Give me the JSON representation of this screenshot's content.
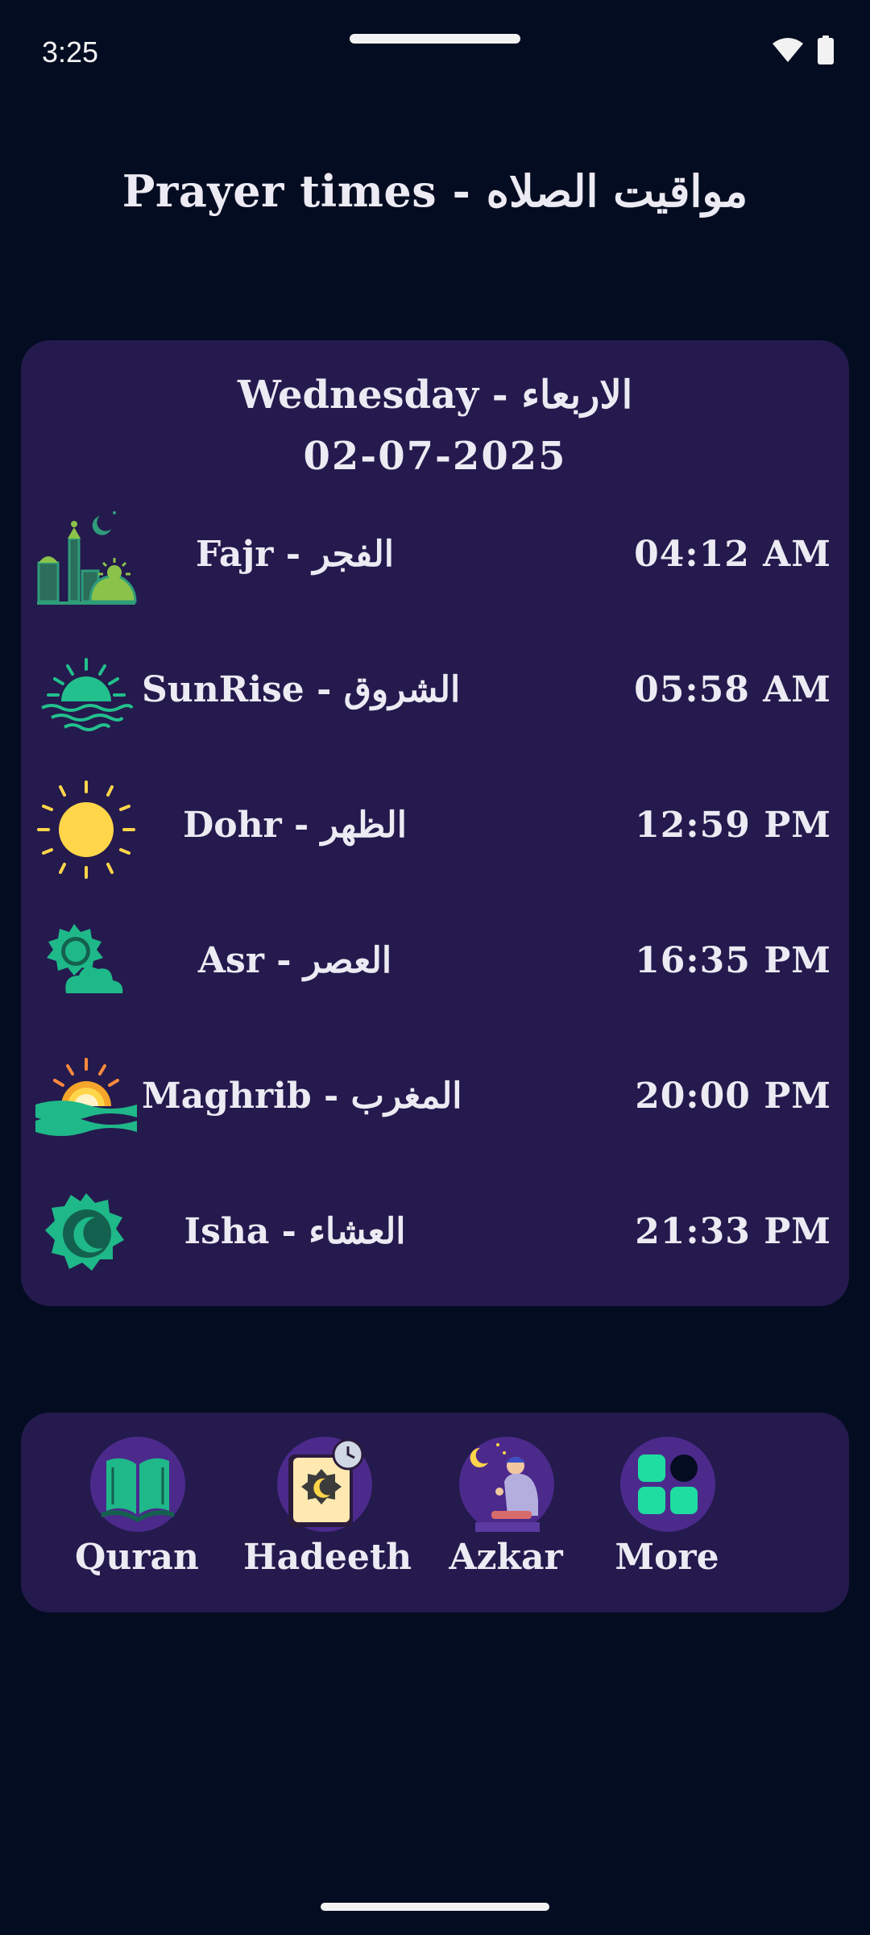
{
  "status_bar": {
    "time": "3:25"
  },
  "header": {
    "title": "Prayer times - مواقيت الصلاه"
  },
  "card": {
    "day": "Wednesday - الاربعاء",
    "date": "02-07-2025",
    "prayers": [
      {
        "name": "Fajr - الفجر",
        "time": "04:12 AM",
        "icon": "mosque-dawn-icon"
      },
      {
        "name": "SunRise - الشروق",
        "time": "05:58 AM",
        "icon": "sunrise-icon"
      },
      {
        "name": "Dohr - الظهر",
        "time": "12:59 PM",
        "icon": "sun-icon"
      },
      {
        "name": "Asr - العصر",
        "time": "16:35 PM",
        "icon": "sun-cloud-icon"
      },
      {
        "name": "Maghrib - المغرب",
        "time": "20:00 PM",
        "icon": "sunset-icon"
      },
      {
        "name": "Isha - العشاء",
        "time": "21:33 PM",
        "icon": "crescent-moon-icon"
      }
    ]
  },
  "nav": {
    "items": [
      {
        "label": "Quran",
        "icon": "quran-book-icon"
      },
      {
        "label": "Hadeeth",
        "icon": "hadeeth-book-icon"
      },
      {
        "label": "Azkar",
        "icon": "praying-person-icon"
      },
      {
        "label": "More",
        "icon": "more-grid-icon"
      }
    ]
  },
  "colors": {
    "background": "#040c21",
    "card": "#241a4d",
    "text": "#eceaf3",
    "accent_green": "#1fb889",
    "accent_yellow": "#ffd54a"
  }
}
